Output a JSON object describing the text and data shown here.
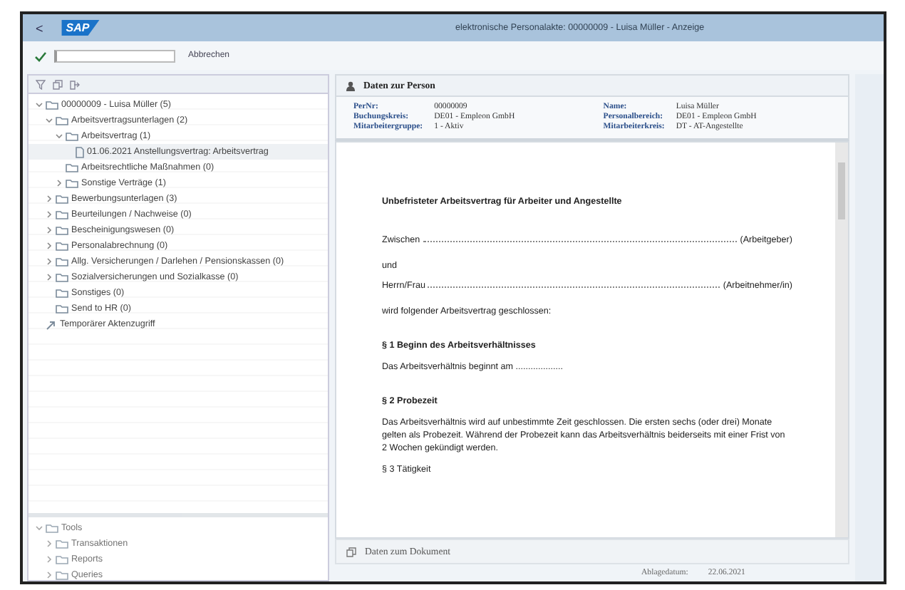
{
  "window": {
    "title": "elektronische Personalakte: 00000009 - Luisa Müller - Anzeige",
    "logo": "SAP",
    "back": "<"
  },
  "toolbar": {
    "cancel": "Abbrechen"
  },
  "tree": [
    {
      "label": "00000009 - Luisa Müller (5)",
      "kind": "folder",
      "expanded": true,
      "selected": false,
      "children": [
        {
          "label": "Arbeitsvertragsunterlagen (2)",
          "kind": "folder",
          "expanded": true,
          "selected": false,
          "children": [
            {
              "label": "Arbeitsvertrag (1)",
              "kind": "folder",
              "expanded": true,
              "selected": false,
              "children": [
                {
                  "label": "01.06.2021 Anstellungsvertrag: Arbeitsvertrag",
                  "kind": "document",
                  "selected": true
                }
              ]
            },
            {
              "label": "Arbeitsrechtliche Maßnahmen (0)",
              "kind": "leaf-folder",
              "selected": false
            },
            {
              "label": "Sonstige Verträge (1)",
              "kind": "folder",
              "expanded": false,
              "selected": false
            }
          ]
        },
        {
          "label": "Bewerbungsunterlagen (3)",
          "kind": "folder",
          "expanded": false,
          "selected": false
        },
        {
          "label": "Beurteilungen / Nachweise (0)",
          "kind": "folder",
          "expanded": false,
          "selected": false
        },
        {
          "label": "Bescheinigungswesen (0)",
          "kind": "folder",
          "expanded": false,
          "selected": false
        },
        {
          "label": "Personalabrechnung (0)",
          "kind": "folder",
          "expanded": false,
          "selected": false
        },
        {
          "label": "Allg. Versicherungen / Darlehen / Pensionskassen (0)",
          "kind": "folder",
          "expanded": false,
          "selected": false
        },
        {
          "label": "Sozialversicherungen und Sozialkasse (0)",
          "kind": "folder",
          "expanded": false,
          "selected": false
        },
        {
          "label": "Sonstiges (0)",
          "kind": "leaf-folder",
          "selected": false
        },
        {
          "label": "Send to HR (0)",
          "kind": "leaf-folder",
          "selected": false
        }
      ]
    },
    {
      "label": "Temporärer Aktenzugriff",
      "kind": "link",
      "selected": false
    }
  ],
  "tools_tree": [
    {
      "label": "Tools",
      "kind": "folder",
      "expanded": true,
      "selected": false,
      "children": [
        {
          "label": "Transaktionen",
          "kind": "folder",
          "expanded": false,
          "selected": false
        },
        {
          "label": "Reports",
          "kind": "folder",
          "expanded": false,
          "selected": false
        },
        {
          "label": "Queries",
          "kind": "folder",
          "expanded": false,
          "selected": false
        }
      ]
    }
  ],
  "person": {
    "title": "Daten zur Person",
    "fields": [
      {
        "label": "PerNr:",
        "value": "00000009"
      },
      {
        "label": "Buchungskreis:",
        "value": "DE01 - Empleon GmbH"
      },
      {
        "label": "Mitarbeitergruppe:",
        "value": "1 - Aktiv"
      },
      {
        "label": "Name:",
        "value": "Luisa Müller"
      },
      {
        "label": "Personalbereich:",
        "value": "DE01 - Empleon GmbH"
      },
      {
        "label": "Mitarbeiterkreis:",
        "value": "DT - AT-Angestellte"
      }
    ]
  },
  "document": {
    "lines": [
      {
        "kind": "heading",
        "text": "Unbefristeter Arbeitsvertrag für Arbeiter und Angestellte"
      },
      {
        "kind": "fill",
        "text": "Zwischen",
        "suffix": "(Arbeitgeber)"
      },
      {
        "kind": "para",
        "text": "und"
      },
      {
        "kind": "fill",
        "text": "Herrn/Frau",
        "suffix": "(Arbeitnehmer/in)"
      },
      {
        "kind": "para",
        "text": "wird folgender Arbeitsvertrag geschlossen:"
      },
      {
        "kind": "heading",
        "text": "§ 1 Beginn des Arbeitsverhältnisses"
      },
      {
        "kind": "para",
        "text": "Das Arbeitsverhältnis beginnt am ..................."
      },
      {
        "kind": "heading",
        "text": "§ 2 Probezeit"
      },
      {
        "kind": "para",
        "text": "Das Arbeitsverhältnis wird auf unbestimmte Zeit geschlossen. Die ersten sechs (oder drei) Monate gelten als Probezeit. Während der Probezeit kann das Arbeitsverhältnis beiderseits mit einer Frist von 2 Wochen gekündigt werden."
      },
      {
        "kind": "para",
        "text": "§ 3 Tätigkeit"
      }
    ]
  },
  "document_info": {
    "title": "Daten zum Dokument",
    "fields": [
      {
        "label": "Ablagedatum:",
        "value": "22.06.2021"
      }
    ]
  }
}
